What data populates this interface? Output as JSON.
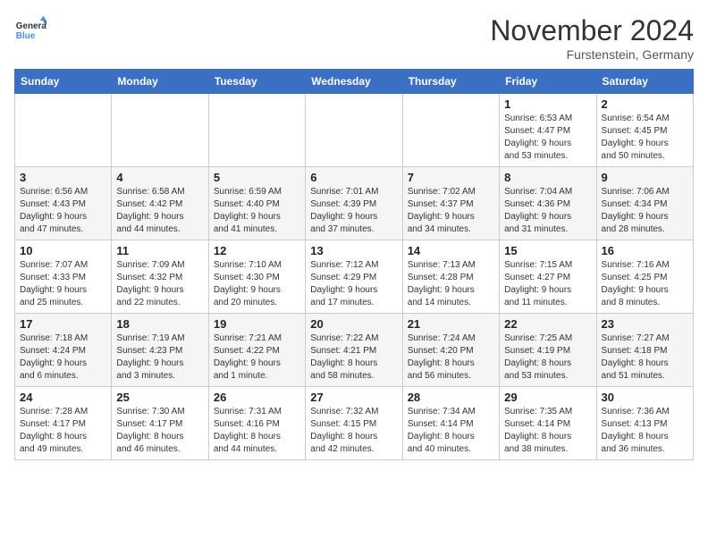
{
  "header": {
    "logo_line1": "General",
    "logo_line2": "Blue",
    "month_title": "November 2024",
    "location": "Furstenstein, Germany"
  },
  "weekdays": [
    "Sunday",
    "Monday",
    "Tuesday",
    "Wednesday",
    "Thursday",
    "Friday",
    "Saturday"
  ],
  "weeks": [
    [
      {
        "day": "",
        "info": ""
      },
      {
        "day": "",
        "info": ""
      },
      {
        "day": "",
        "info": ""
      },
      {
        "day": "",
        "info": ""
      },
      {
        "day": "",
        "info": ""
      },
      {
        "day": "1",
        "info": "Sunrise: 6:53 AM\nSunset: 4:47 PM\nDaylight: 9 hours\nand 53 minutes."
      },
      {
        "day": "2",
        "info": "Sunrise: 6:54 AM\nSunset: 4:45 PM\nDaylight: 9 hours\nand 50 minutes."
      }
    ],
    [
      {
        "day": "3",
        "info": "Sunrise: 6:56 AM\nSunset: 4:43 PM\nDaylight: 9 hours\nand 47 minutes."
      },
      {
        "day": "4",
        "info": "Sunrise: 6:58 AM\nSunset: 4:42 PM\nDaylight: 9 hours\nand 44 minutes."
      },
      {
        "day": "5",
        "info": "Sunrise: 6:59 AM\nSunset: 4:40 PM\nDaylight: 9 hours\nand 41 minutes."
      },
      {
        "day": "6",
        "info": "Sunrise: 7:01 AM\nSunset: 4:39 PM\nDaylight: 9 hours\nand 37 minutes."
      },
      {
        "day": "7",
        "info": "Sunrise: 7:02 AM\nSunset: 4:37 PM\nDaylight: 9 hours\nand 34 minutes."
      },
      {
        "day": "8",
        "info": "Sunrise: 7:04 AM\nSunset: 4:36 PM\nDaylight: 9 hours\nand 31 minutes."
      },
      {
        "day": "9",
        "info": "Sunrise: 7:06 AM\nSunset: 4:34 PM\nDaylight: 9 hours\nand 28 minutes."
      }
    ],
    [
      {
        "day": "10",
        "info": "Sunrise: 7:07 AM\nSunset: 4:33 PM\nDaylight: 9 hours\nand 25 minutes."
      },
      {
        "day": "11",
        "info": "Sunrise: 7:09 AM\nSunset: 4:32 PM\nDaylight: 9 hours\nand 22 minutes."
      },
      {
        "day": "12",
        "info": "Sunrise: 7:10 AM\nSunset: 4:30 PM\nDaylight: 9 hours\nand 20 minutes."
      },
      {
        "day": "13",
        "info": "Sunrise: 7:12 AM\nSunset: 4:29 PM\nDaylight: 9 hours\nand 17 minutes."
      },
      {
        "day": "14",
        "info": "Sunrise: 7:13 AM\nSunset: 4:28 PM\nDaylight: 9 hours\nand 14 minutes."
      },
      {
        "day": "15",
        "info": "Sunrise: 7:15 AM\nSunset: 4:27 PM\nDaylight: 9 hours\nand 11 minutes."
      },
      {
        "day": "16",
        "info": "Sunrise: 7:16 AM\nSunset: 4:25 PM\nDaylight: 9 hours\nand 8 minutes."
      }
    ],
    [
      {
        "day": "17",
        "info": "Sunrise: 7:18 AM\nSunset: 4:24 PM\nDaylight: 9 hours\nand 6 minutes."
      },
      {
        "day": "18",
        "info": "Sunrise: 7:19 AM\nSunset: 4:23 PM\nDaylight: 9 hours\nand 3 minutes."
      },
      {
        "day": "19",
        "info": "Sunrise: 7:21 AM\nSunset: 4:22 PM\nDaylight: 9 hours\nand 1 minute."
      },
      {
        "day": "20",
        "info": "Sunrise: 7:22 AM\nSunset: 4:21 PM\nDaylight: 8 hours\nand 58 minutes."
      },
      {
        "day": "21",
        "info": "Sunrise: 7:24 AM\nSunset: 4:20 PM\nDaylight: 8 hours\nand 56 minutes."
      },
      {
        "day": "22",
        "info": "Sunrise: 7:25 AM\nSunset: 4:19 PM\nDaylight: 8 hours\nand 53 minutes."
      },
      {
        "day": "23",
        "info": "Sunrise: 7:27 AM\nSunset: 4:18 PM\nDaylight: 8 hours\nand 51 minutes."
      }
    ],
    [
      {
        "day": "24",
        "info": "Sunrise: 7:28 AM\nSunset: 4:17 PM\nDaylight: 8 hours\nand 49 minutes."
      },
      {
        "day": "25",
        "info": "Sunrise: 7:30 AM\nSunset: 4:17 PM\nDaylight: 8 hours\nand 46 minutes."
      },
      {
        "day": "26",
        "info": "Sunrise: 7:31 AM\nSunset: 4:16 PM\nDaylight: 8 hours\nand 44 minutes."
      },
      {
        "day": "27",
        "info": "Sunrise: 7:32 AM\nSunset: 4:15 PM\nDaylight: 8 hours\nand 42 minutes."
      },
      {
        "day": "28",
        "info": "Sunrise: 7:34 AM\nSunset: 4:14 PM\nDaylight: 8 hours\nand 40 minutes."
      },
      {
        "day": "29",
        "info": "Sunrise: 7:35 AM\nSunset: 4:14 PM\nDaylight: 8 hours\nand 38 minutes."
      },
      {
        "day": "30",
        "info": "Sunrise: 7:36 AM\nSunset: 4:13 PM\nDaylight: 8 hours\nand 36 minutes."
      }
    ]
  ]
}
